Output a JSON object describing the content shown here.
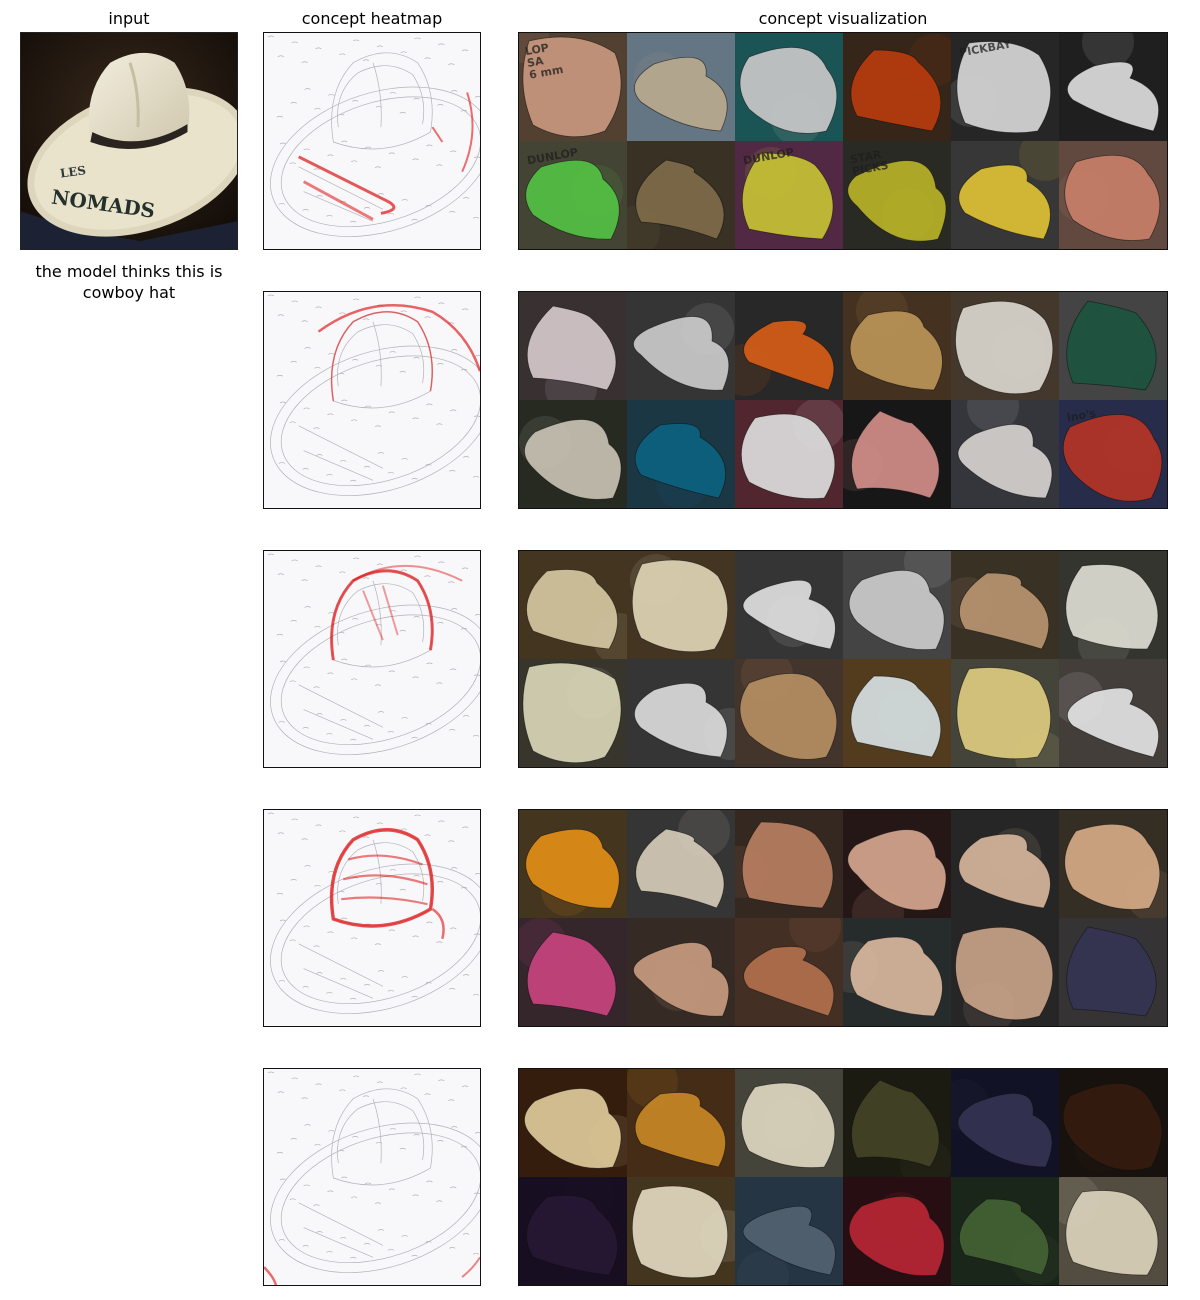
{
  "titles": {
    "input": "input",
    "heatmap": "concept heatmap",
    "visualization": "concept visualization"
  },
  "caption": {
    "line1": "the model thinks this is",
    "line2": "cowboy hat"
  },
  "input_image": {
    "subject": "cowboy hat",
    "hat_text_top": "LES",
    "hat_text_main": "NOMADS"
  },
  "concepts": [
    {
      "heat_focus": "brim-text",
      "tiles": [
        {
          "bg": "#5a4636",
          "fg": "#d9a58a",
          "text": "LOP\nSA\n6 mm"
        },
        {
          "bg": "#6d7f8f",
          "fg": "#c9b79a",
          "text": ""
        },
        {
          "bg": "#1d5c5c",
          "fg": "#d9d9d9",
          "text": ""
        },
        {
          "bg": "#3a2a1c",
          "fg": "#c8400f",
          "text": ""
        },
        {
          "bg": "#2a2a2a",
          "fg": "#e8e8e8",
          "text": "PICKBAY"
        },
        {
          "bg": "#222222",
          "fg": "#f0f0f0",
          "text": ""
        },
        {
          "bg": "#4a4a3a",
          "fg": "#5bd14a",
          "text": "DUNLOP"
        },
        {
          "bg": "#3d3628",
          "fg": "#8a7450",
          "text": ""
        },
        {
          "bg": "#5a2d4a",
          "fg": "#d8d23a",
          "text": "DUNLOP"
        },
        {
          "bg": "#2e2e28",
          "fg": "#c9c22c",
          "text": "STAR\nPICKS"
        },
        {
          "bg": "#3c3c3c",
          "fg": "#f2d13a",
          "text": ""
        },
        {
          "bg": "#6a5046",
          "fg": "#d98a72",
          "text": ""
        }
      ]
    },
    {
      "heat_focus": "crown-edge",
      "tiles": [
        {
          "bg": "#3d3536",
          "fg": "#e6d9dc",
          "text": ""
        },
        {
          "bg": "#3a3a3a",
          "fg": "#dcdcdc",
          "text": ""
        },
        {
          "bg": "#2c2c2c",
          "fg": "#e8651a",
          "text": ""
        },
        {
          "bg": "#4a3622",
          "fg": "#c9a060",
          "text": ""
        },
        {
          "bg": "#4a3c30",
          "fg": "#ece8e0",
          "text": ""
        },
        {
          "bg": "#4a4a4a",
          "fg": "#1e5a44",
          "text": ""
        },
        {
          "bg": "#2a2e24",
          "fg": "#d8d2c2",
          "text": ""
        },
        {
          "bg": "#1e3c4a",
          "fg": "#0e6a8a",
          "text": ""
        },
        {
          "bg": "#5a2a34",
          "fg": "#f0f0f0",
          "text": ""
        },
        {
          "bg": "#1a1a1a",
          "fg": "#e49a94",
          "text": ""
        },
        {
          "bg": "#3a3a42",
          "fg": "#e8e4e0",
          "text": ""
        },
        {
          "bg": "#2a3050",
          "fg": "#c43a2a",
          "text": "ino's"
        }
      ]
    },
    {
      "heat_focus": "crown-top",
      "tiles": [
        {
          "bg": "#4a3a24",
          "fg": "#e8d8b0",
          "text": ""
        },
        {
          "bg": "#4a3a26",
          "fg": "#f2e6c4",
          "text": ""
        },
        {
          "bg": "#3a3a3a",
          "fg": "#f2f2f2",
          "text": ""
        },
        {
          "bg": "#4a4a4a",
          "fg": "#dcdcdc",
          "text": ""
        },
        {
          "bg": "#3e3628",
          "fg": "#c8a078",
          "text": ""
        },
        {
          "bg": "#3a3a34",
          "fg": "#f0f0e4",
          "text": ""
        },
        {
          "bg": "#3c3a30",
          "fg": "#ece8c8",
          "text": ""
        },
        {
          "bg": "#3a3a3a",
          "fg": "#eeeeee",
          "text": ""
        },
        {
          "bg": "#4a3a30",
          "fg": "#c49a6a",
          "text": ""
        },
        {
          "bg": "#5a4220",
          "fg": "#e8f2f4",
          "text": ""
        },
        {
          "bg": "#4a4a40",
          "fg": "#f0dc8a",
          "text": ""
        },
        {
          "bg": "#4a4440",
          "fg": "#f6f6f6",
          "text": ""
        }
      ]
    },
    {
      "heat_focus": "crown-full",
      "tiles": [
        {
          "bg": "#4a3a22",
          "fg": "#f39a1a",
          "text": ""
        },
        {
          "bg": "#3a3a3a",
          "fg": "#e8dcc8",
          "text": ""
        },
        {
          "bg": "#3a2c24",
          "fg": "#c88a6a",
          "text": ""
        },
        {
          "bg": "#2a1a1a",
          "fg": "#e6b49a",
          "text": ""
        },
        {
          "bg": "#2a2a2a",
          "fg": "#e8c4a8",
          "text": ""
        },
        {
          "bg": "#3a3228",
          "fg": "#e8b890",
          "text": ""
        },
        {
          "bg": "#3a2a30",
          "fg": "#d84a8a",
          "text": ""
        },
        {
          "bg": "#3a2e28",
          "fg": "#d8a88a",
          "text": ""
        },
        {
          "bg": "#4a3428",
          "fg": "#c07a54",
          "text": ""
        },
        {
          "bg": "#2a3030",
          "fg": "#ecc8ac",
          "text": ""
        },
        {
          "bg": "#2a2a2a",
          "fg": "#d8b094",
          "text": ""
        },
        {
          "bg": "#3a3838",
          "fg": "#3a3a5a",
          "text": ""
        }
      ]
    },
    {
      "heat_focus": "corner",
      "tiles": [
        {
          "bg": "#3a2010",
          "fg": "#f2dca8",
          "text": ""
        },
        {
          "bg": "#4a3018",
          "fg": "#d8922a",
          "text": ""
        },
        {
          "bg": "#4a4a40",
          "fg": "#f0e8d0",
          "text": ""
        },
        {
          "bg": "#1e1e14",
          "fg": "#4a4a2a",
          "text": ""
        },
        {
          "bg": "#14142a",
          "fg": "#3a3a5a",
          "text": ""
        },
        {
          "bg": "#1a1410",
          "fg": "#3a2010",
          "text": ""
        },
        {
          "bg": "#1a1024",
          "fg": "#2a1a3a",
          "text": ""
        },
        {
          "bg": "#4a3a22",
          "fg": "#f4ecd0",
          "text": ""
        },
        {
          "bg": "#2a3a4a",
          "fg": "#5a6a7a",
          "text": ""
        },
        {
          "bg": "#2a1014",
          "fg": "#c82a3a",
          "text": ""
        },
        {
          "bg": "#1e2a1e",
          "fg": "#4a6a3a",
          "text": ""
        },
        {
          "bg": "#5a5446",
          "fg": "#eee4cc",
          "text": ""
        }
      ]
    }
  ]
}
